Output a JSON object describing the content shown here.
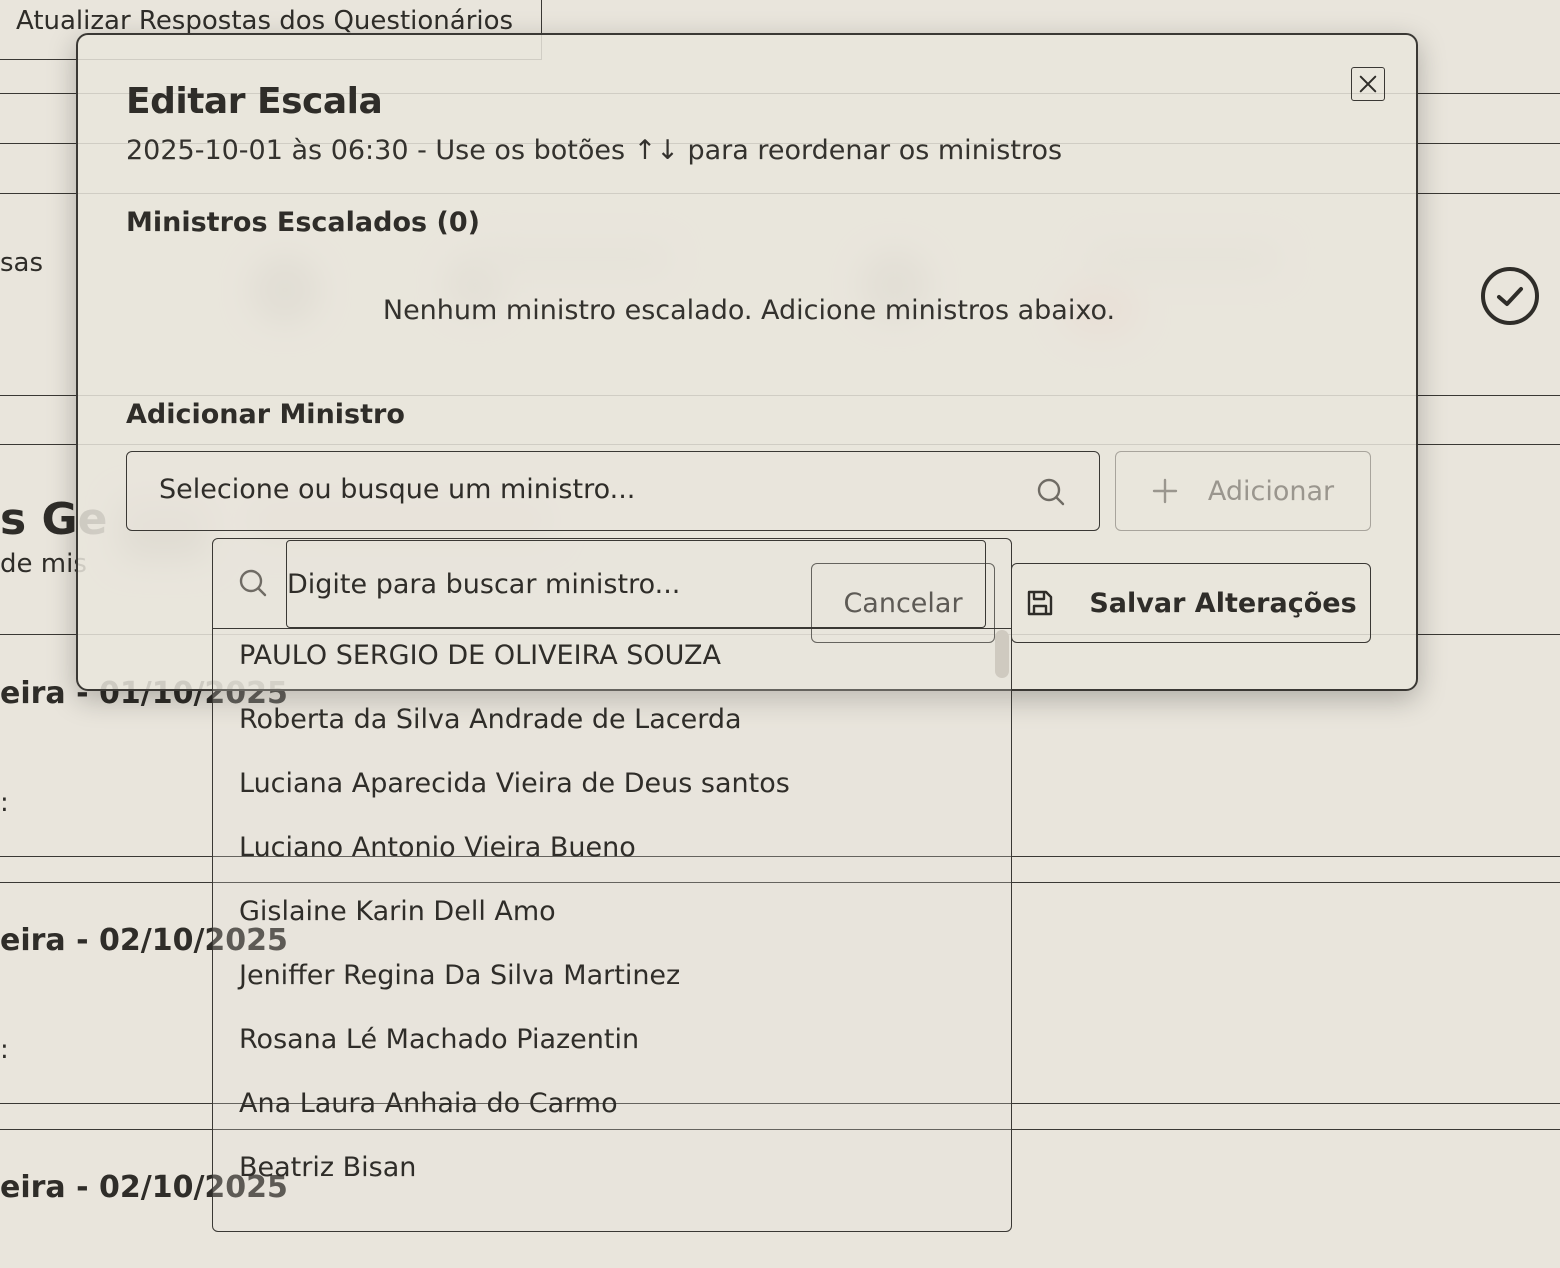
{
  "background": {
    "tab_label": "Atualizar Respostas dos Questionários",
    "side_text_1": "sas",
    "heading_fragment": "s Ge",
    "subheading_fragment": "de mis",
    "rows": [
      {
        "title_fragment": "eira - 01/10/2025",
        "colon": ":"
      },
      {
        "title_fragment": "eira - 02/10/2025",
        "colon": ":"
      },
      {
        "title_fragment": "eira - 02/10/2025"
      }
    ]
  },
  "dialog": {
    "title": "Editar Escala",
    "subtitle": "2025-10-01 às 06:30 - Use os botões ↑↓ para reordenar os ministros",
    "scheduled_heading": "Ministros Escalados (0)",
    "empty_message": "Nenhum ministro escalado. Adicione ministros abaixo.",
    "add_heading": "Adicionar Ministro",
    "select_placeholder": "Selecione ou busque um ministro...",
    "add_button": "Adicionar",
    "cancel_button": "Cancelar",
    "save_button": "Salvar Alterações"
  },
  "dropdown": {
    "search_placeholder": "Digite para buscar ministro...",
    "items": [
      "PAULO SERGIO DE OLIVEIRA SOUZA",
      "Roberta da Silva Andrade de Lacerda",
      "Luciana Aparecida Vieira de Deus santos",
      "Luciano Antonio Vieira Bueno",
      "Gislaine Karin Dell Amo",
      "Jeniffer Regina Da Silva Martinez",
      "Rosana Lé Machado Piazentin",
      "Ana Laura Anhaia do Carmo",
      "Beatriz Bisan"
    ]
  },
  "icons": {
    "close": "x-icon",
    "search": "search-icon",
    "plus": "plus-icon",
    "save": "floppy-disk-icon",
    "check": "check-circle-icon"
  },
  "colors": {
    "background": "#e9e5dc",
    "text": "#2f2d29",
    "border": "#3a3834",
    "disabled": "#9a968e"
  }
}
